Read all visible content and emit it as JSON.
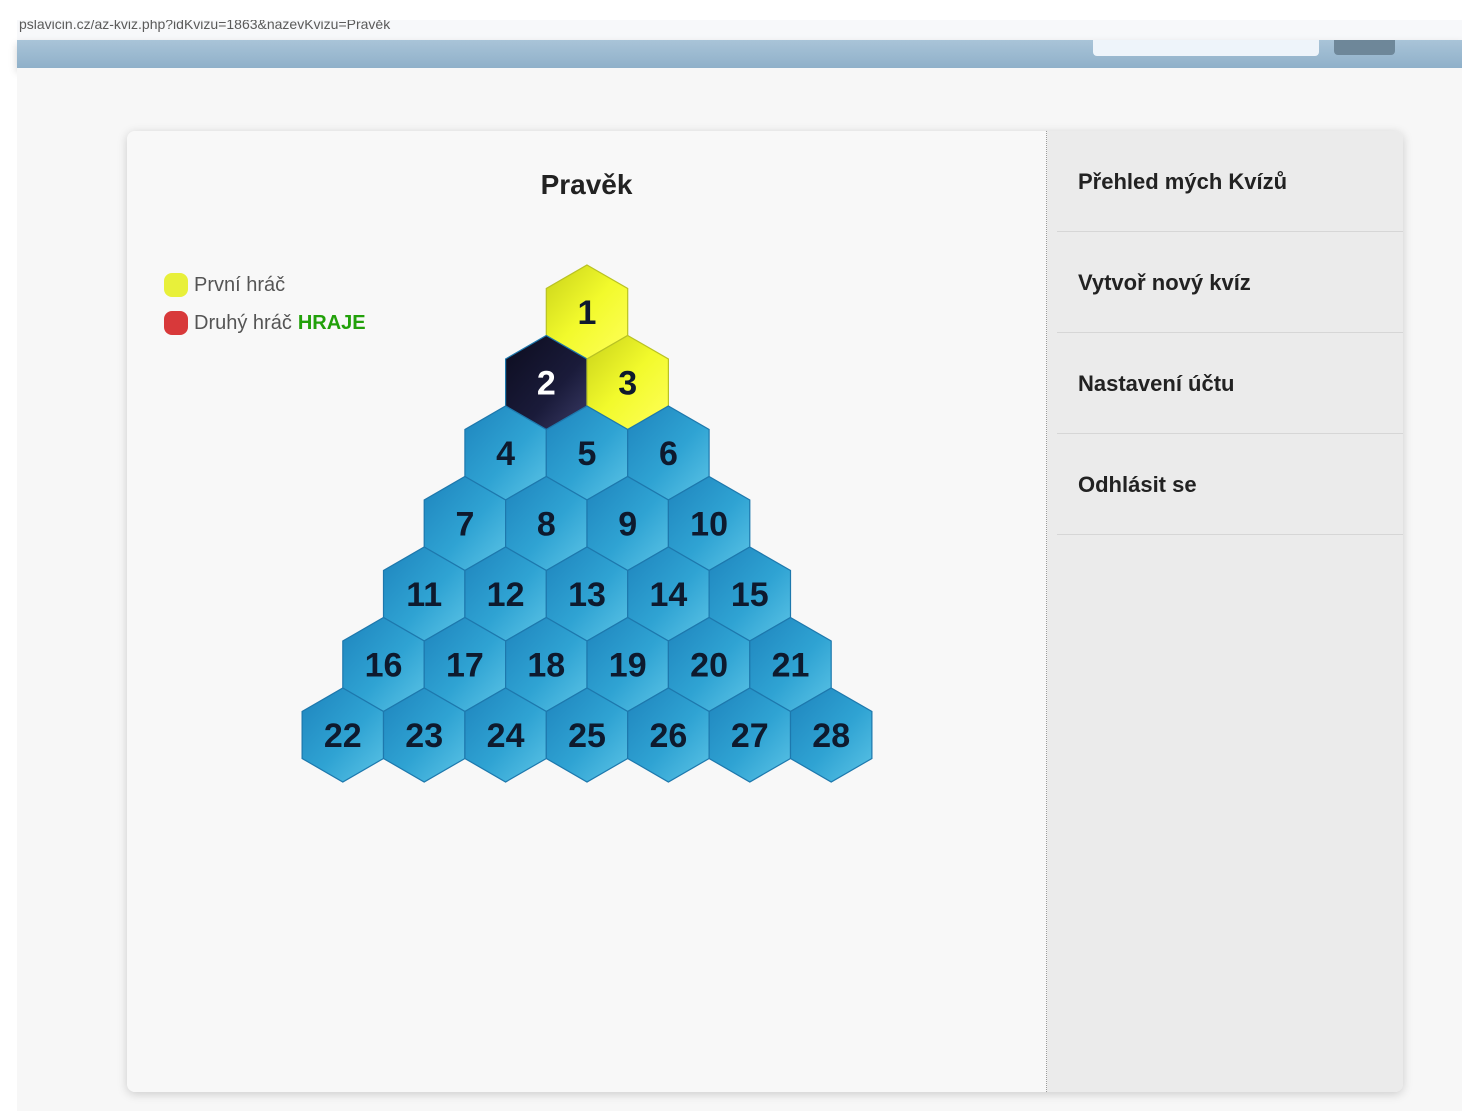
{
  "browser": {
    "url": "pslavicin.cz/az-kviz.php?idKvizu=1863&nazevKvizu=Pravěk"
  },
  "quiz": {
    "title": "Pravěk"
  },
  "players": [
    {
      "label": "První hráč",
      "color": "#e8f03a",
      "status": ""
    },
    {
      "label": "Druhý hráč",
      "color": "#d8393a",
      "status": "HRAJE"
    }
  ],
  "board": {
    "rows": 7,
    "colors": {
      "unplayed": "#2a9fd0",
      "player1": "#e8f53a",
      "missed": "#1a1b3a"
    },
    "cells": [
      {
        "number": "1",
        "state": "player1"
      },
      {
        "number": "2",
        "state": "missed"
      },
      {
        "number": "3",
        "state": "player1"
      },
      {
        "number": "4",
        "state": "unplayed"
      },
      {
        "number": "5",
        "state": "unplayed"
      },
      {
        "number": "6",
        "state": "unplayed"
      },
      {
        "number": "7",
        "state": "unplayed"
      },
      {
        "number": "8",
        "state": "unplayed"
      },
      {
        "number": "9",
        "state": "unplayed"
      },
      {
        "number": "10",
        "state": "unplayed"
      },
      {
        "number": "11",
        "state": "unplayed"
      },
      {
        "number": "12",
        "state": "unplayed"
      },
      {
        "number": "13",
        "state": "unplayed"
      },
      {
        "number": "14",
        "state": "unplayed"
      },
      {
        "number": "15",
        "state": "unplayed"
      },
      {
        "number": "16",
        "state": "unplayed"
      },
      {
        "number": "17",
        "state": "unplayed"
      },
      {
        "number": "18",
        "state": "unplayed"
      },
      {
        "number": "19",
        "state": "unplayed"
      },
      {
        "number": "20",
        "state": "unplayed"
      },
      {
        "number": "21",
        "state": "unplayed"
      },
      {
        "number": "22",
        "state": "unplayed"
      },
      {
        "number": "23",
        "state": "unplayed"
      },
      {
        "number": "24",
        "state": "unplayed"
      },
      {
        "number": "25",
        "state": "unplayed"
      },
      {
        "number": "26",
        "state": "unplayed"
      },
      {
        "number": "27",
        "state": "unplayed"
      },
      {
        "number": "28",
        "state": "unplayed"
      }
    ]
  },
  "sidebar": {
    "items": [
      {
        "label": "Přehled mých Kvízů"
      },
      {
        "label": "Vytvoř nový kvíz"
      },
      {
        "label": "Nastavení účtu"
      },
      {
        "label": "Odhlásit se"
      }
    ]
  }
}
